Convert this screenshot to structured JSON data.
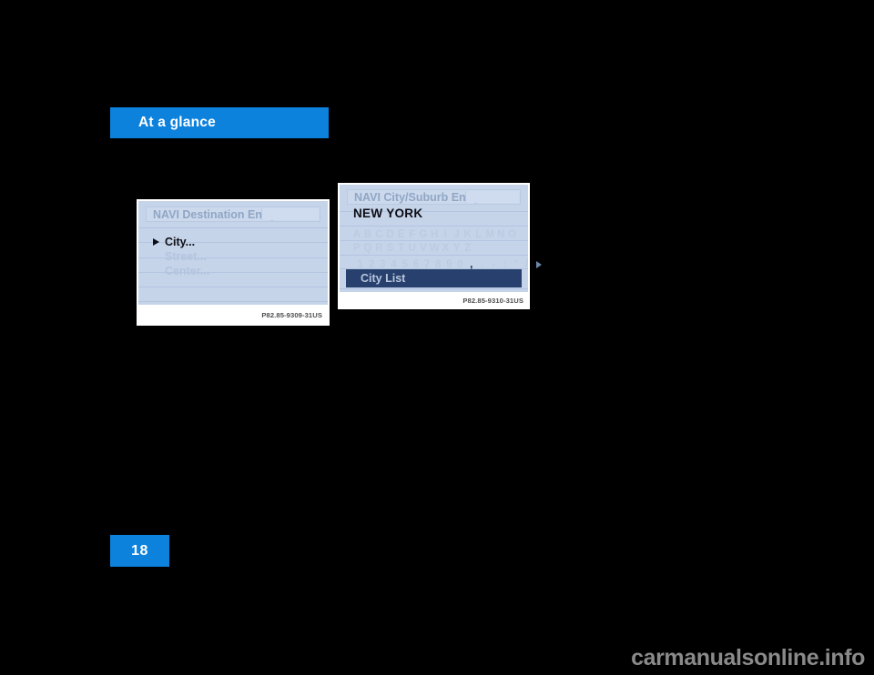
{
  "header": {
    "title": "At a glance"
  },
  "page": {
    "number": "18"
  },
  "watermark": {
    "text": "carmanualsonline.info"
  },
  "figures": [
    {
      "id": "navi-destination-entry",
      "titlebar": "NAVI Destination Entry",
      "menu_items": [
        {
          "label": "City...",
          "state": "active",
          "marker": "triangle-right-marker"
        },
        {
          "label": "Street...",
          "state": "dim",
          "marker": ""
        },
        {
          "label": "Center...",
          "state": "dim",
          "marker": ""
        }
      ],
      "caption": "P82.85-9309-31US"
    },
    {
      "id": "navi-city-suburb-entry",
      "titlebar": "NAVI City/Suburb Entry",
      "entry_value": "NEW YORK",
      "keyboard": {
        "row1": [
          "A",
          "B",
          "C",
          "D",
          "E",
          "F",
          "G",
          "H",
          "I",
          "J",
          "K",
          "L",
          "M",
          "N",
          "O"
        ],
        "row2": [
          "P",
          "Q",
          "R",
          "S",
          "T",
          "U",
          "V",
          "W",
          "X",
          "Y",
          "Z"
        ],
        "row3": [
          "1",
          "2",
          "3",
          "4",
          "5",
          "6",
          "7",
          "8",
          "9",
          "0",
          ",",
          ".",
          "-",
          ":",
          "'",
          "/"
        ],
        "row3_selected": ",",
        "more_key": "arrow-right-icon"
      },
      "action_bar": "City List",
      "caption": "P82.85-9310-31US"
    }
  ],
  "colors": {
    "accent_blue": "#0d82dd",
    "screen_background": "#c6d4ea",
    "titlebar_background": "#ccd9ed",
    "titlebar_text": "#8fa6c4",
    "highlight_bar": "#27406e",
    "highlight_text": "#b9c6dc",
    "dim_text": "#b3c4dd",
    "key_text": "#bccbe2",
    "page_background": "#000000"
  }
}
